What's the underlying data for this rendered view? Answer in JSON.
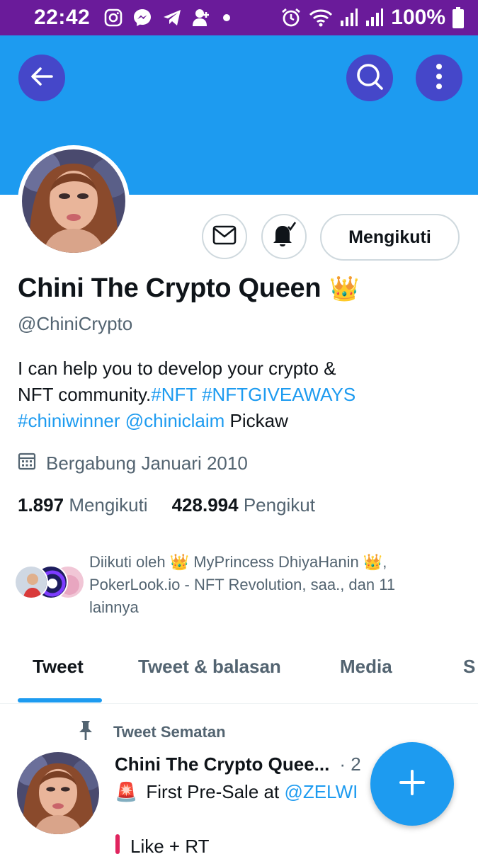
{
  "status_bar": {
    "time": "22:42",
    "battery": "100%",
    "left_icons": [
      "instagram-icon",
      "messenger-icon",
      "telegram-icon",
      "add-contact-icon",
      "dot-icon"
    ],
    "right_icons": [
      "alarm-icon",
      "wifi-icon",
      "signal-icon",
      "signal-icon",
      "battery-icon"
    ]
  },
  "header": {
    "back_icon": "arrow-left-icon",
    "search_icon": "search-icon",
    "more_icon": "more-vertical-icon"
  },
  "profile": {
    "display_name": "Chini The Crypto Queen",
    "name_emoji": "👑",
    "handle": "@ChiniCrypto",
    "bio_segments": [
      {
        "text": "I can help you to develop your crypto & ",
        "type": "text"
      },
      {
        "text": "NFT community.",
        "type": "text"
      },
      {
        "text": "#NFT",
        "type": "link"
      },
      {
        "text": " ",
        "type": "text"
      },
      {
        "text": "#NFTGIVEAWAYS",
        "type": "link"
      },
      {
        "text": " ",
        "type": "text"
      },
      {
        "text": "#chiniwinner",
        "type": "link"
      },
      {
        "text": " ",
        "type": "text"
      },
      {
        "text": "@chiniclaim",
        "type": "link"
      },
      {
        "text": " Pickaw",
        "type": "text"
      }
    ],
    "joined": "Bergabung Januari 2010",
    "following_count": "1.897",
    "following_label": "Mengikuti",
    "followers_count": "428.994",
    "followers_label": "Pengikut",
    "follow_button": "Mengikuti",
    "message_icon": "mail-icon",
    "notify_icon": "bell-check-icon",
    "followed_by": "Diikuti oleh 👑 MyPrincess DhiyaHanin 👑, PokerLook.io - NFT Revolution, saa., dan 11 lainnya"
  },
  "tabs": [
    {
      "label": "Tweet",
      "active": true
    },
    {
      "label": "Tweet & balasan",
      "active": false
    },
    {
      "label": "Media",
      "active": false
    },
    {
      "label": "S",
      "active": false
    }
  ],
  "pinned_tweet": {
    "pinned_label": "Tweet Sematan",
    "author": "Chini The Crypto Quee...",
    "meta": "· 2",
    "line1_prefix": "🚨",
    "line1_text": "First Pre-Sale at ",
    "line1_link": "@ZELWI",
    "line2_text": "Like + RT"
  },
  "fab": {
    "icon": "plus-icon"
  },
  "colors": {
    "status_bar": "#6a1b9a",
    "banner": "#1d9bf0",
    "header_buttons": "#4547c9",
    "accent": "#1d9bf0",
    "secondary_text": "#536471"
  }
}
